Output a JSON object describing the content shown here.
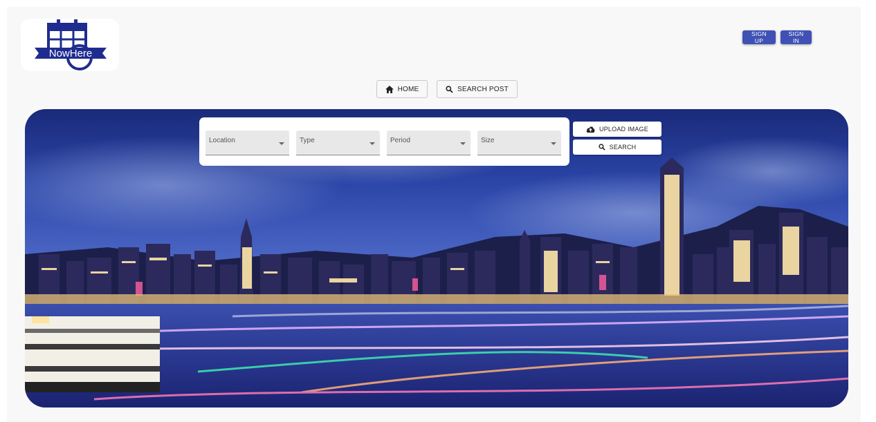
{
  "brand": {
    "logo_text": "NowHere",
    "color": "#1f2c8f"
  },
  "header": {
    "sign_up_label": "SIGN UP",
    "sign_in_label": "SIGN IN",
    "accent": "#3f51b5"
  },
  "nav": {
    "home_label": "HOME",
    "home_icon": "home-icon",
    "search_post_label": "SEARCH POST",
    "search_post_icon": "search-icon"
  },
  "filters": [
    {
      "label": "Location"
    },
    {
      "label": "Type"
    },
    {
      "label": "Period"
    },
    {
      "label": "Size"
    }
  ],
  "actions": {
    "upload_label": "UPLOAD IMAGE",
    "upload_icon": "cloud-upload-icon",
    "search_label": "SEARCH",
    "search_icon": "search-icon"
  },
  "hero": {
    "description_icon": "city-skyline-photo"
  }
}
